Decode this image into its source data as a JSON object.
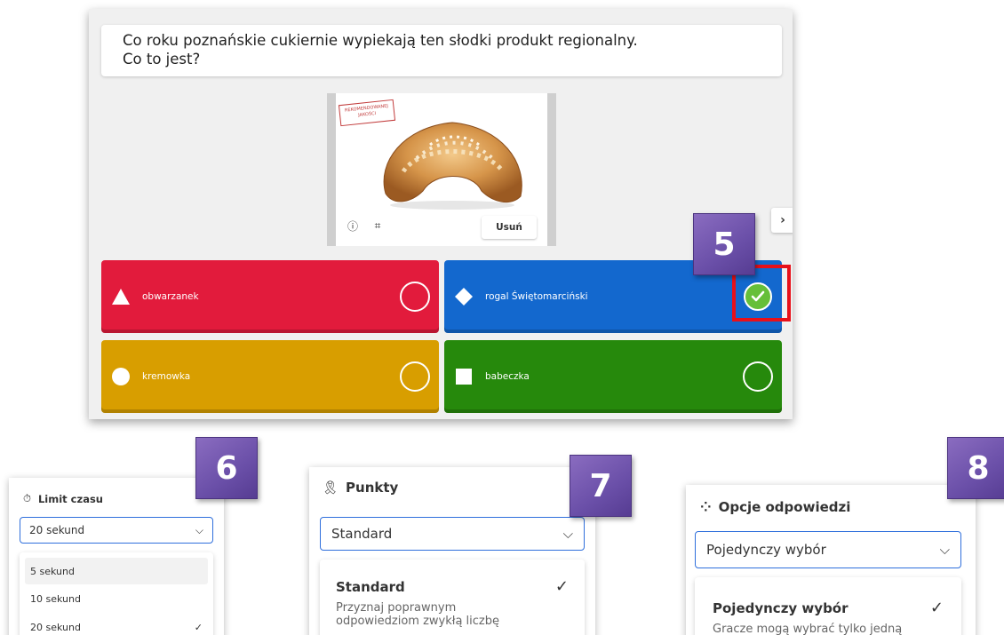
{
  "question": {
    "line1": "Co roku poznańskie cukiernie wypiekają ten słodki produkt regionalny.",
    "line2": "Co to jest?"
  },
  "image": {
    "stamp_text": "REKOMENDOWANEJ JAKOŚCI",
    "remove_label": "Usuń"
  },
  "answers": [
    {
      "label": "obwarzanek",
      "shape": "triangle",
      "color": "#e21b3c",
      "correct": false
    },
    {
      "label": "rogal Świętomarciński",
      "shape": "diamond",
      "color": "#1368ce",
      "correct": true
    },
    {
      "label": "kremowka",
      "shape": "circle",
      "color": "#d89e00",
      "correct": false
    },
    {
      "label": "babeczka",
      "shape": "square",
      "color": "#26890c",
      "correct": false
    }
  ],
  "badges": {
    "b5": "5",
    "b6": "6",
    "b7": "7",
    "b8": "8"
  },
  "time_limit": {
    "heading": "Limit czasu",
    "selected": "20 sekund",
    "options": [
      "5 sekund",
      "10 sekund",
      "20 sekund"
    ]
  },
  "points": {
    "heading": "Punkty",
    "selected": "Standard",
    "option_title": "Standard",
    "option_desc_1": "Przyznaj poprawnym",
    "option_desc_2": "odpowiedziom zwykłą liczbę"
  },
  "answer_options": {
    "heading": "Opcje odpowiedzi",
    "selected": "Pojedynczy wybór",
    "option_title": "Pojedynczy wybór",
    "option_desc_1": "Gracze mogą wybrać tylko jedną"
  },
  "colors": {
    "highlight": "#e8101a",
    "badge": "#6a4fa8",
    "correct": "#66bf39"
  }
}
